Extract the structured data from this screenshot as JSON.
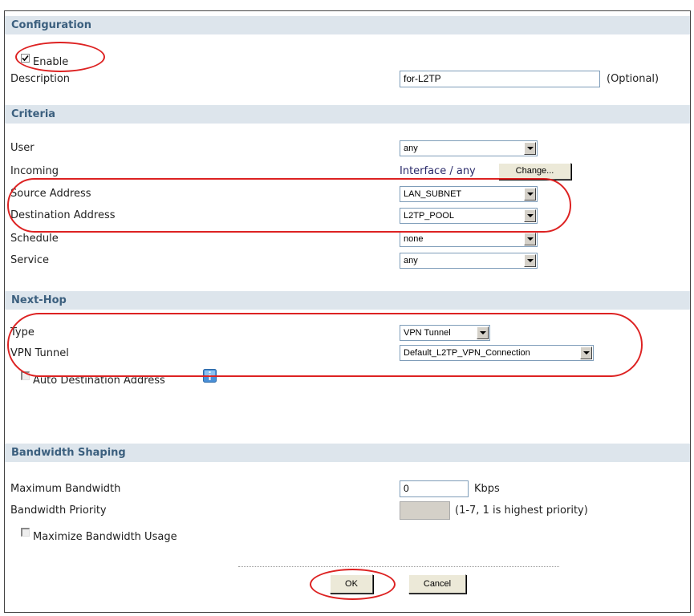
{
  "sections": {
    "configuration": "Configuration",
    "criteria": "Criteria",
    "nexthop": "Next-Hop",
    "bandwidth": "Bandwidth Shaping"
  },
  "configuration": {
    "enable_label": "Enable",
    "enable_checked": true,
    "description_label": "Description",
    "description_value": "for-L2TP",
    "optional_text": "(Optional)"
  },
  "criteria": {
    "user_label": "User",
    "user_value": "any",
    "incoming_label": "Incoming",
    "incoming_value": "Interface / any",
    "change_button": "Change...",
    "source_label": "Source Address",
    "source_value": "LAN_SUBNET",
    "destination_label": "Destination Address",
    "destination_value": "L2TP_POOL",
    "schedule_label": "Schedule",
    "schedule_value": "none",
    "service_label": "Service",
    "service_value": "any"
  },
  "nexthop": {
    "type_label": "Type",
    "type_value": "VPN Tunnel",
    "tunnel_label": "VPN Tunnel",
    "tunnel_value": "Default_L2TP_VPN_Connection",
    "auto_dest_label": "Auto Destination Address",
    "auto_dest_checked": false
  },
  "bandwidth": {
    "max_label": "Maximum Bandwidth",
    "max_value": "0",
    "max_unit": "Kbps",
    "priority_label": "Bandwidth Priority",
    "priority_value": "",
    "priority_hint": "(1-7, 1 is highest priority)",
    "maximize_label": "Maximize Bandwidth Usage",
    "maximize_checked": false
  },
  "buttons": {
    "ok": "OK",
    "cancel": "Cancel"
  },
  "colors": {
    "section_bg": "#dde5ec",
    "section_text": "#3b5f7e",
    "highlight_ring": "#dd2222"
  }
}
